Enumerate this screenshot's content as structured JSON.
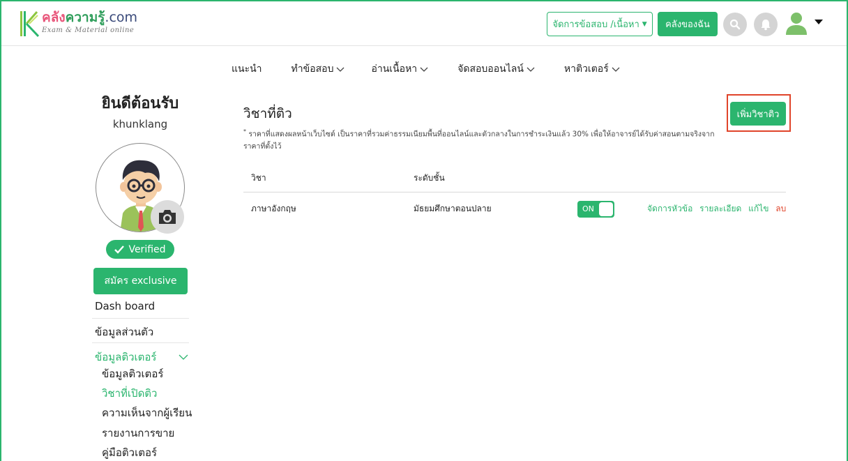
{
  "header": {
    "logo_main_prefix": "คลัง",
    "logo_main_rest": "ความรู้",
    "logo_main_suffix": ".com",
    "logo_sub": "Exam & Material online",
    "manage_btn": "จัดการข้อสอบ /เนื้อหา",
    "my_library_btn": "คลังของฉัน",
    "icons": [
      "search-icon",
      "bell-icon",
      "user-icon",
      "caret-down-icon"
    ]
  },
  "nav": {
    "items": [
      {
        "label": "แนะนำ",
        "dropdown": false
      },
      {
        "label": "ทำข้อสอบ",
        "dropdown": true
      },
      {
        "label": "อ่านเนื้อหา",
        "dropdown": true
      },
      {
        "label": "จัดสอบออนไลน์",
        "dropdown": true
      },
      {
        "label": "หาติวเตอร์",
        "dropdown": true
      }
    ]
  },
  "sidebar": {
    "welcome": "ยินดีต้อนรับ",
    "username": "khunklang",
    "verified": "Verified",
    "exclusive_btn": "สมัคร exclusive",
    "items": [
      {
        "label": "Dash board"
      },
      {
        "label": "ข้อมูลส่วนตัว"
      },
      {
        "label": "ข้อมูลติวเตอร์"
      }
    ],
    "sub_items": [
      {
        "label": "ข้อมูลติวเตอร์"
      },
      {
        "label": "วิชาที่เปิดติว"
      },
      {
        "label": "ความเห็นจากผู้เรียน"
      },
      {
        "label": "รายงานการขาย"
      },
      {
        "label": "คู่มือติวเตอร์"
      }
    ]
  },
  "main": {
    "title": "วิชาที่ติว",
    "note_mark": "*",
    "note": "ราคาที่แสดงผลหน้าเว็บไซต์ เป็นราคาที่รวมค่าธรรมเนียมพื้นที่ออนไลน์และตัวกลางในการชำระเงินแล้ว 30% เพื่อให้อาจารย์ได้รับค่าสอนตามจริงจากราคาที่ตั้งไว้",
    "add_btn": "เพิ่มวิชาติว",
    "table": {
      "headers": [
        "วิชา",
        "ระดับชั้น"
      ],
      "rows": [
        {
          "subject": "ภาษาอังกฤษ",
          "level": "มัธยมศึกษาตอนปลาย",
          "toggle": "ON",
          "actions": [
            "จัดการหัวข้อ",
            "รายละเอียด",
            "แก้ไข"
          ],
          "delete": "ลบ"
        }
      ]
    }
  },
  "colors": {
    "accent": "#2bb56e",
    "danger": "#e0442a",
    "highlight_border": "#e0442a"
  }
}
